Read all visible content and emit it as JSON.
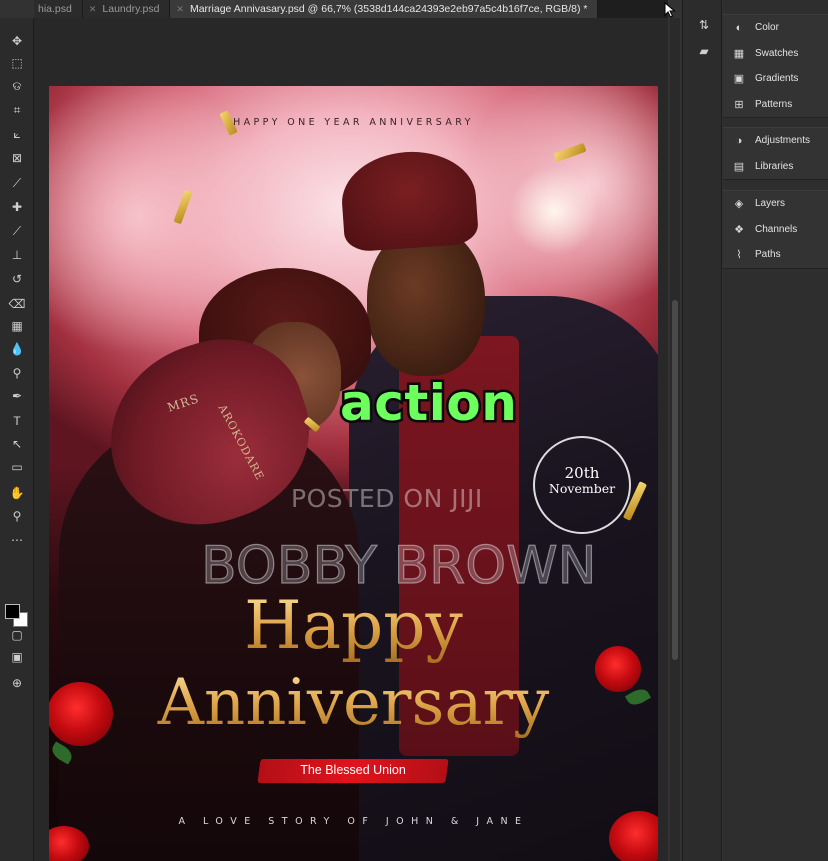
{
  "tabs": [
    {
      "label": "hia.psd",
      "active": false
    },
    {
      "label": "Laundry.psd",
      "active": false
    },
    {
      "label": "Marriage Annivasary.psd @ 66,7% (3538d144ca24393e2eb97a5c4b16f7ce, RGB/8) *",
      "active": true
    }
  ],
  "tools": [
    "move-tool",
    "marquee-tool",
    "lasso-tool",
    "object-select-tool",
    "crop-tool",
    "frame-tool",
    "eyedropper-tool",
    "healing-brush-tool",
    "brush-tool",
    "clone-stamp-tool",
    "history-brush-tool",
    "eraser-tool",
    "gradient-tool",
    "blur-tool",
    "dodge-tool",
    "pen-tool",
    "type-tool",
    "path-select-tool",
    "rectangle-tool",
    "hand-tool",
    "zoom-tool",
    "more-tools"
  ],
  "tool_glyphs": [
    "✥",
    "⬚",
    "ଡ",
    "⌗",
    "⟀",
    "⊠",
    "⟋",
    "✚",
    "⟋",
    "⊥",
    "↺",
    "⌫",
    "▦",
    "💧",
    "⚲",
    "✒",
    "T",
    "↖",
    "▭",
    "✋",
    "⚲",
    "⋯"
  ],
  "panels": {
    "group1": [
      {
        "label": "Color",
        "icon": "color-icon",
        "glyph": "◐"
      },
      {
        "label": "Swatches",
        "icon": "swatches-icon",
        "glyph": "▦"
      },
      {
        "label": "Gradients",
        "icon": "gradients-icon",
        "glyph": "▣"
      },
      {
        "label": "Patterns",
        "icon": "patterns-icon",
        "glyph": "⊞"
      }
    ],
    "group2": [
      {
        "label": "Adjustments",
        "icon": "adjustments-icon",
        "glyph": "◑"
      },
      {
        "label": "Libraries",
        "icon": "libraries-icon",
        "glyph": "▤"
      }
    ],
    "group3": [
      {
        "label": "Layers",
        "icon": "layers-icon",
        "glyph": "◈"
      },
      {
        "label": "Channels",
        "icon": "channels-icon",
        "glyph": "❖"
      },
      {
        "label": "Paths",
        "icon": "paths-icon",
        "glyph": "⌇"
      }
    ]
  },
  "poster": {
    "top_line": "HAPPY ONE YEAR  ANNIVERSARY",
    "fan_text_top": "MRS",
    "fan_text_side": "AROKODARE",
    "date_day": "20th",
    "date_month": "November",
    "watermark_posted": "POSTED ON JIJI",
    "watermark_name": "BOBBY BROWN",
    "title_line1": "Happy",
    "title_line2": "Anniversary",
    "ribbon": "The Blessed Union",
    "bottom_line": "A LOVE STORY OF JOHN & JANE"
  },
  "caption": "action",
  "colors": {
    "caption": "#6dff5d",
    "gold": "#e0a64a",
    "ribbon": "#e0141c"
  }
}
